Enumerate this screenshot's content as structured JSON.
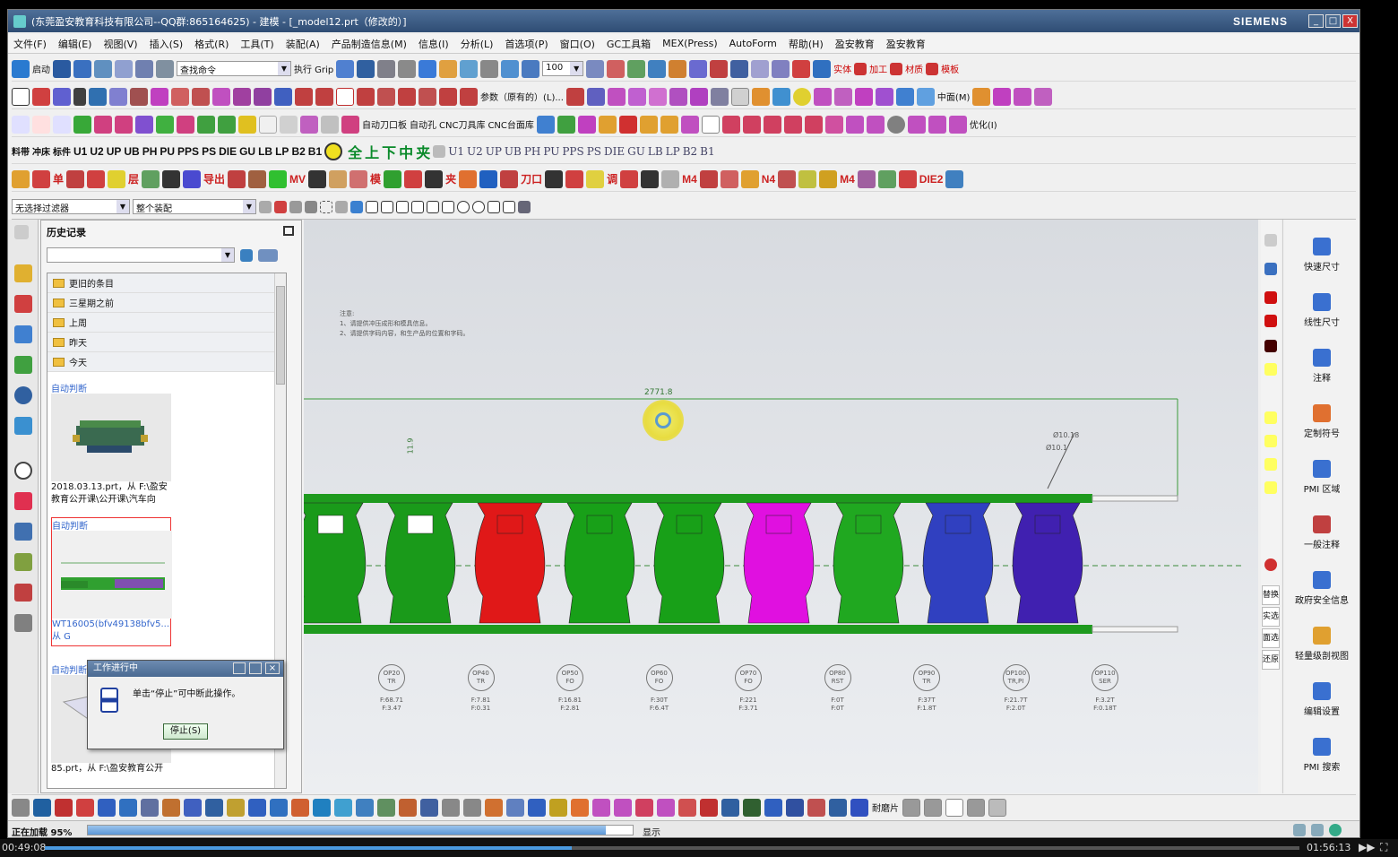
{
  "window": {
    "title": "(东莞盈安教育科技有限公司--QQ群:865164625) - 建模 - [_model12.prt（修改的）]",
    "brand": "SIEMENS",
    "controls": [
      "_",
      "□",
      "X"
    ]
  },
  "menu": [
    "文件(F)",
    "编辑(E)",
    "视图(V)",
    "插入(S)",
    "格式(R)",
    "工具(T)",
    "装配(A)",
    "产品制造信息(M)",
    "信息(I)",
    "分析(L)",
    "首选项(P)",
    "窗口(O)",
    "GC工具箱",
    "MEX(Press)",
    "AutoForm",
    "帮助(H)",
    "盈安教育",
    "盈安教育"
  ],
  "toolbar1": {
    "start": "启动",
    "search_placeholder": "查找命令",
    "exec": "执行 Grip",
    "zoom": "100",
    "labels": [
      "实体",
      "加工",
      "材质",
      "模板"
    ]
  },
  "toolbar2": {
    "param": "参数（原有的）(L)...",
    "zhongmian": "中面(M)"
  },
  "toolbar3": {
    "labels": [
      "自动刀口板",
      "自动孔",
      "CNC刀具库",
      "CNC台面库"
    ],
    "opt": "优化(I)"
  },
  "toolbar4": {
    "items": [
      "U1",
      "U2",
      "UP",
      "UB",
      "PH",
      "PU",
      "PPS",
      "PS",
      "DIE",
      "GU",
      "LB",
      "LP",
      "B2",
      "B1"
    ],
    "green": [
      "全",
      "上",
      "下",
      "中",
      "夹"
    ],
    "items2": [
      "U1",
      "U2",
      "UP",
      "UB",
      "PH",
      "PU",
      "PPS",
      "PS",
      "DIE",
      "GU",
      "LB",
      "LP",
      "B2",
      "B1"
    ]
  },
  "toolbar5": {
    "labels": [
      "单",
      "层",
      "导出",
      "MV",
      "模",
      "夹",
      "刀口",
      "调",
      "M4",
      "N4",
      "M4",
      "DIE2"
    ]
  },
  "filter": {
    "select_filter": "无选择过滤器",
    "assembly": "整个装配"
  },
  "history": {
    "title": "历史记录",
    "folders": [
      "更旧的条目",
      "三星期之前",
      "上周",
      "昨天",
      "今天"
    ],
    "cards": [
      {
        "tag": "自动判断",
        "caption": "2018.03.13.prt，从 F:\\盈安教育公开课\\公开课\\汽车向"
      },
      {
        "tag": "自动判断",
        "caption": "WT16005(bfv49138bfv5...，从 G"
      },
      {
        "tag": "自动判断",
        "caption": "85.prt，从 F:\\盈安教育公开"
      }
    ]
  },
  "dialog": {
    "title": "工作进行中",
    "message": "单击“停止”可中断此操作。",
    "button": "停止(S)"
  },
  "canvas": {
    "note_title": "注意:",
    "note_lines": [
      "1、请提供冲压成形和模具信息。",
      "2、请提供字码内容，和生产品的位置和字码。"
    ],
    "dim_top": "2771.8",
    "dim_left": "11.9",
    "dim_r1": "Ø10.18",
    "dim_r2": "Ø10.1",
    "ops": [
      {
        "op": "OP20",
        "t": "TR",
        "f1": "F:68.71",
        "f2": "F:3.47"
      },
      {
        "op": "OP40",
        "t": "TR",
        "f1": "F:7.81",
        "f2": "F:0.31"
      },
      {
        "op": "OP50",
        "t": "FO",
        "f1": "F:16.81",
        "f2": "F:2.81"
      },
      {
        "op": "OP60",
        "t": "FO",
        "f1": "F:30T",
        "f2": "F:6.4T"
      },
      {
        "op": "OP70",
        "t": "FO",
        "f1": "F:221",
        "f2": "F:3.71"
      },
      {
        "op": "OP80",
        "t": "RST",
        "f1": "F:0T",
        "f2": "F:0T"
      },
      {
        "op": "OP90",
        "t": "TR",
        "f1": "F:37T",
        "f2": "F:1.8T"
      },
      {
        "op": "OP100",
        "t": "TR,PI",
        "f1": "F:21.7T",
        "f2": "F:2.0T"
      },
      {
        "op": "OP110",
        "t": "SER",
        "f1": "F:3.2T",
        "f2": "F:0.18T"
      }
    ],
    "part_colors": [
      "#1a9a1a",
      "#1a9a1a",
      "#e01818",
      "#18a018",
      "#18a018",
      "#e010e0",
      "#20a820",
      "#3040c0",
      "#4020b0"
    ]
  },
  "right_palette": [
    "替换",
    "实选",
    "面选",
    "还原"
  ],
  "right_panel": [
    "快速尺寸",
    "线性尺寸",
    "注释",
    "定制符号",
    "PMI 区域",
    "一般注释",
    "政府安全信息",
    "轻量级剖视图",
    "编辑设置",
    "PMI 搜索"
  ],
  "bottom": {
    "label": "耐磨片"
  },
  "status": {
    "loading": "正在加载 95%",
    "show": "显示",
    "progress": 0.95
  },
  "player": {
    "elapsed": "00:49:08",
    "total": "01:56:13",
    "progress": 0.42
  }
}
